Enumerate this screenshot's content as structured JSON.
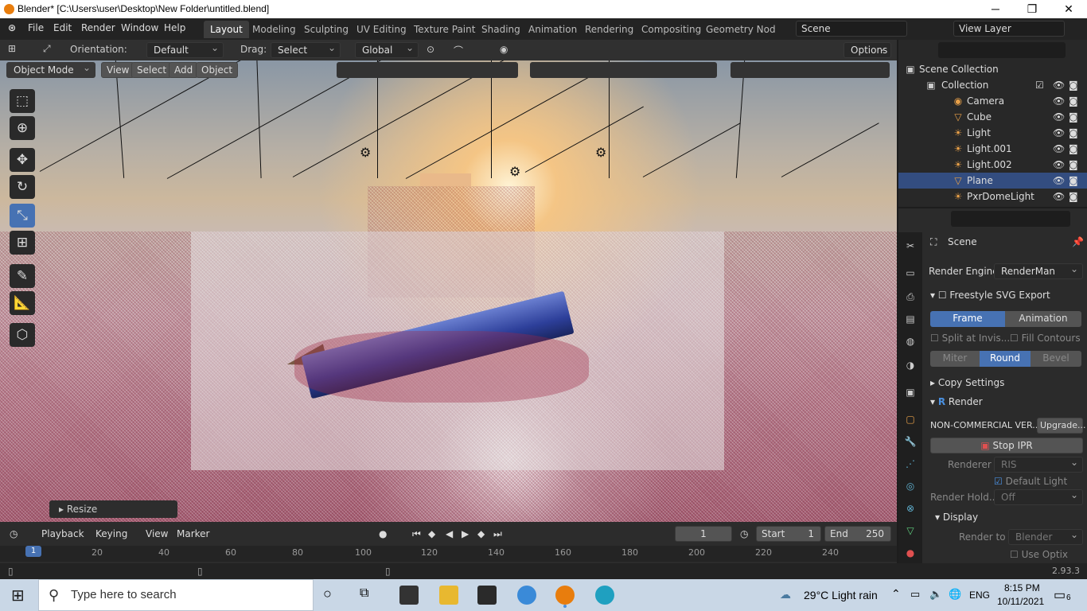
{
  "window": {
    "title": "Blender* [C:\\Users\\user\\Desktop\\New Folder\\untitled.blend]",
    "minimize": "─",
    "maximize": "❐",
    "close": "✕"
  },
  "menu": {
    "file": "File",
    "edit": "Edit",
    "render": "Render",
    "window": "Window",
    "help": "Help"
  },
  "workspaces": [
    "Layout",
    "Modeling",
    "Sculpting",
    "UV Editing",
    "Texture Paint",
    "Shading",
    "Animation",
    "Rendering",
    "Compositing",
    "Geometry Nod"
  ],
  "scene": "Scene",
  "view_layer": "View Layer",
  "header": {
    "orientation_label": "Orientation:",
    "orientation": "Default",
    "drag_label": "Drag:",
    "drag": "Select Box",
    "transform": "Global",
    "options": "Options"
  },
  "viewport": {
    "mode": "Object Mode",
    "view": "View",
    "select": "Select",
    "add": "Add",
    "object": "Object",
    "resize_panel": "Resize"
  },
  "timeline": {
    "playback": "Playback",
    "keying": "Keying",
    "view": "View",
    "marker": "Marker",
    "current_frame": "1",
    "start_label": "Start",
    "start": "1",
    "end_label": "End",
    "end": "250",
    "ticks": [
      "1",
      "20",
      "40",
      "60",
      "80",
      "100",
      "120",
      "140",
      "160",
      "180",
      "200",
      "220",
      "240"
    ]
  },
  "outliner": {
    "root": "Scene Collection",
    "collection": "Collection",
    "items": [
      "Camera",
      "Cube",
      "Light",
      "Light.001",
      "Light.002",
      "Plane",
      "PxrDomeLight"
    ]
  },
  "properties": {
    "title": "Scene",
    "render_engine_label": "Render Engine",
    "render_engine": "RenderMan",
    "freestyle": "Freestyle SVG Export",
    "frame": "Frame",
    "animation": "Animation",
    "split_at_invis": "Split at Invis...",
    "fill_contours": "Fill Contours",
    "miter": "Miter",
    "round": "Round",
    "bevel": "Bevel",
    "copy_settings": "Copy Settings",
    "render": "Render",
    "non_commercial": "NON-COMMERCIAL VER...",
    "upgrade": "Upgrade...",
    "stop_ipr": "Stop IPR",
    "renderer_label": "Renderer",
    "renderer": "RIS",
    "default_light": "Default Light",
    "render_hold_label": "Render Hold...",
    "render_hold": "Off",
    "display": "Display",
    "render_to_label": "Render to",
    "render_to": "Blender",
    "use_optix": "Use Optix D..."
  },
  "status": {
    "version": "2.93.3"
  },
  "taskbar": {
    "search_placeholder": "Type here to search",
    "weather": "29°C  Light rain",
    "lang": "ENG",
    "time": "8:15 PM",
    "date": "10/11/2021",
    "notifications": "6"
  }
}
